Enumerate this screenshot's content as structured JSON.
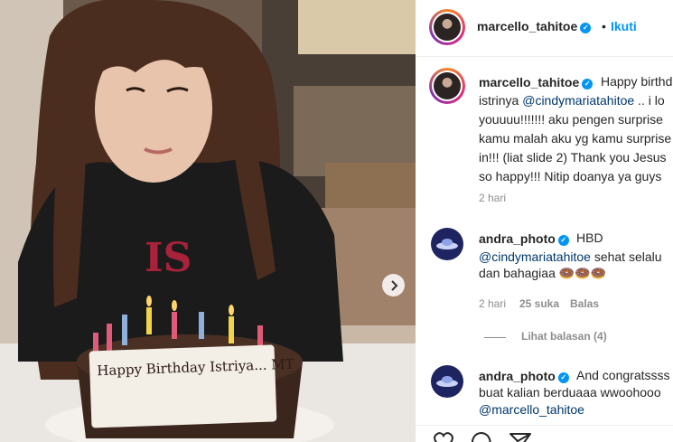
{
  "post": {
    "cake_message": "Happy Birthday Istriya... MT",
    "next_icon": "chevron-right-icon"
  },
  "header": {
    "username": "marcello_tahitoe",
    "separator": "•",
    "follow_label": "Ikuti"
  },
  "caption": {
    "username": "marcello_tahitoe",
    "text_pre": "Happy birthd",
    "line2_pre": "istrinya ",
    "mention": "@cindymariatahitoe",
    "line2_post": " .. i lo",
    "line3": "youuuu!!!!!!! aku pengen surprise",
    "line4": "kamu malah aku yg kamu surprise",
    "line5": "in!!! (liat slide 2) Thank you Jesus",
    "line6": "so happy!!! Nitip doanya ya guys",
    "time": "2 hari"
  },
  "comments": [
    {
      "username": "andra_photo",
      "text_first": "HBD",
      "mention": "@cindymariatahitoe",
      "text_after_mention": " sehat selalu",
      "line3": "dan bahagiaa",
      "emojis": "🍩🍩🍩",
      "time": "2 hari",
      "likes": "25 suka",
      "reply_label": "Balas",
      "view_replies": "Lihat balasan (4)"
    },
    {
      "username": "andra_photo",
      "text_first": "And congratssss",
      "line2": "buat kalian berduaaa wwoohooo",
      "mention": "@marcello_tahitoe"
    }
  ],
  "actions": {
    "like_icon": "heart-icon",
    "comment_icon": "comment-icon",
    "share_icon": "send-icon"
  },
  "colors": {
    "accent": "#0095f6",
    "mention": "#00376b",
    "meta": "#8e8e8e"
  }
}
